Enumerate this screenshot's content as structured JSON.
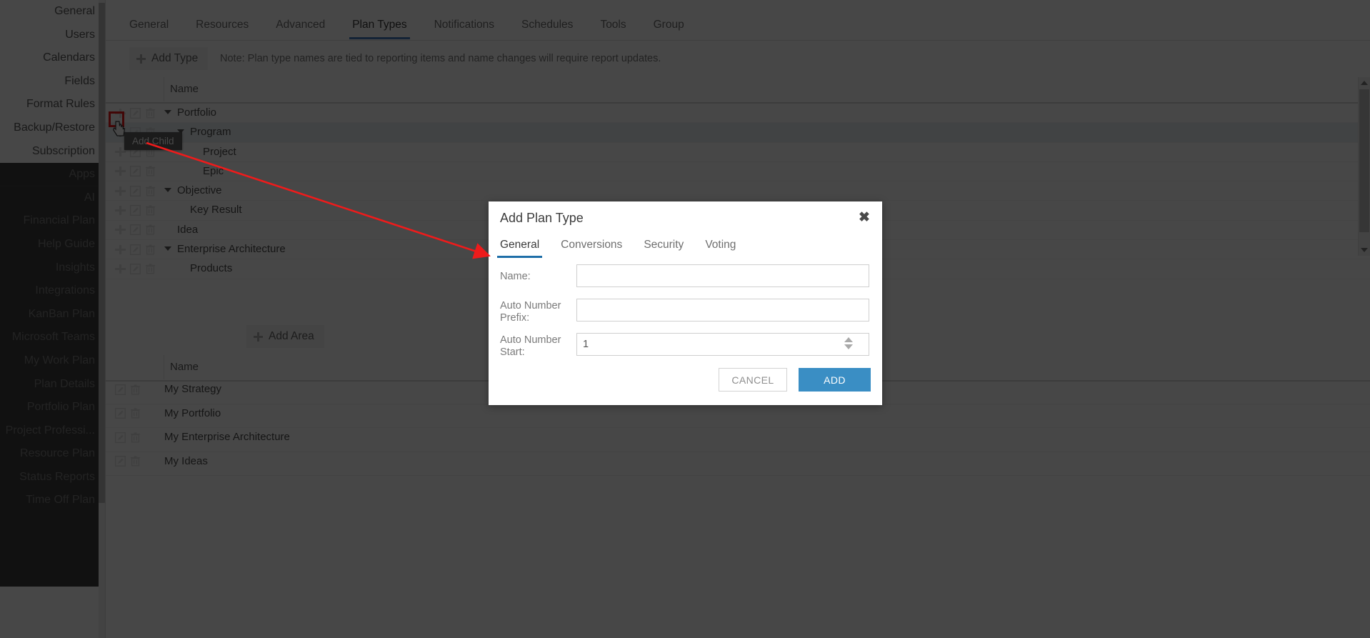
{
  "sidebar": {
    "top_items": [
      {
        "label": "General",
        "selected": true
      },
      {
        "label": "Users",
        "selected": false
      },
      {
        "label": "Calendars",
        "selected": false
      },
      {
        "label": "Fields",
        "selected": false
      },
      {
        "label": "Format Rules",
        "selected": false
      },
      {
        "label": "Backup/Restore",
        "selected": false
      },
      {
        "label": "Subscription",
        "selected": false
      }
    ],
    "apps_label": "Apps",
    "app_items": [
      {
        "label": "AI"
      },
      {
        "label": "Financial Plan"
      },
      {
        "label": "Help Guide"
      },
      {
        "label": "Insights"
      },
      {
        "label": "Integrations"
      },
      {
        "label": "KanBan Plan"
      },
      {
        "label": "Microsoft Teams"
      },
      {
        "label": "My Work Plan"
      },
      {
        "label": "Plan Details"
      },
      {
        "label": "Portfolio Plan"
      },
      {
        "label": "Project Professi..."
      },
      {
        "label": "Resource Plan"
      },
      {
        "label": "Status Reports"
      },
      {
        "label": "Time Off Plan"
      }
    ]
  },
  "tabs": [
    {
      "label": "General",
      "active": false
    },
    {
      "label": "Resources",
      "active": false
    },
    {
      "label": "Advanced",
      "active": false
    },
    {
      "label": "Plan Types",
      "active": true
    },
    {
      "label": "Notifications",
      "active": false
    },
    {
      "label": "Schedules",
      "active": false
    },
    {
      "label": "Tools",
      "active": false
    },
    {
      "label": "Group",
      "active": false
    }
  ],
  "toolbar": {
    "add_type_label": "Add Type",
    "note": "Note: Plan type names are tied to reporting items and name changes will require report updates."
  },
  "tree_grid": {
    "column_header_name": "Name",
    "rows": [
      {
        "label": "Portfolio",
        "indent": 0,
        "expandable": true,
        "highlighted": false
      },
      {
        "label": "Program",
        "indent": 1,
        "expandable": true,
        "highlighted": true
      },
      {
        "label": "Project",
        "indent": 2,
        "expandable": false,
        "highlighted": false
      },
      {
        "label": "Epic",
        "indent": 2,
        "expandable": false,
        "highlighted": false
      },
      {
        "label": "Objective",
        "indent": 0,
        "expandable": true,
        "highlighted": false
      },
      {
        "label": "Key Result",
        "indent": 1,
        "expandable": false,
        "highlighted": false
      },
      {
        "label": "Idea",
        "indent": 0,
        "expandable": false,
        "highlighted": false
      },
      {
        "label": "Enterprise Architecture",
        "indent": 0,
        "expandable": true,
        "highlighted": false
      },
      {
        "label": "Products",
        "indent": 1,
        "expandable": false,
        "highlighted": false
      }
    ]
  },
  "tooltip": {
    "text": "Add Child"
  },
  "area_grid": {
    "add_area_label": "Add Area",
    "column_header_name": "Name",
    "rows": [
      {
        "label": "My Strategy"
      },
      {
        "label": "My Portfolio"
      },
      {
        "label": "My Enterprise Architecture"
      },
      {
        "label": "My Ideas"
      }
    ]
  },
  "dialog": {
    "title": "Add Plan Type",
    "close_label": "✖",
    "tabs": [
      {
        "label": "General",
        "active": true
      },
      {
        "label": "Conversions",
        "active": false
      },
      {
        "label": "Security",
        "active": false
      },
      {
        "label": "Voting",
        "active": false
      }
    ],
    "fields": {
      "name_label": "Name:",
      "name_value": "",
      "name_placeholder": "",
      "prefix_label": "Auto Number Prefix:",
      "prefix_value": "",
      "prefix_placeholder": "",
      "start_label": "Auto Number Start:",
      "start_value": "1"
    },
    "cancel_label": "CANCEL",
    "add_label": "ADD"
  },
  "colors": {
    "accent_blue": "#3a8ec4",
    "tab_underline": "#4a7fc1",
    "dialog_tab_underline": "#1e6ea8",
    "annotation_red": "#ee1b1b",
    "row_highlight": "#e9eff3",
    "sidebar_dark": "#3d3d3d"
  }
}
